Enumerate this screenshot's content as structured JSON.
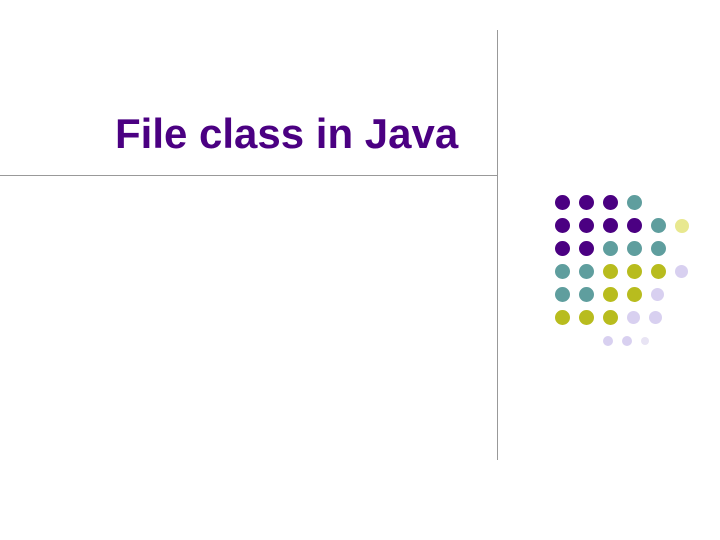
{
  "slide": {
    "title": "File class in Java"
  },
  "colors": {
    "purple": "#4b0082",
    "teal": "#5f9e9e",
    "olive": "#b8bc1e",
    "paleyellow": "#e8e88f",
    "lavender": "#d8d0f0"
  }
}
